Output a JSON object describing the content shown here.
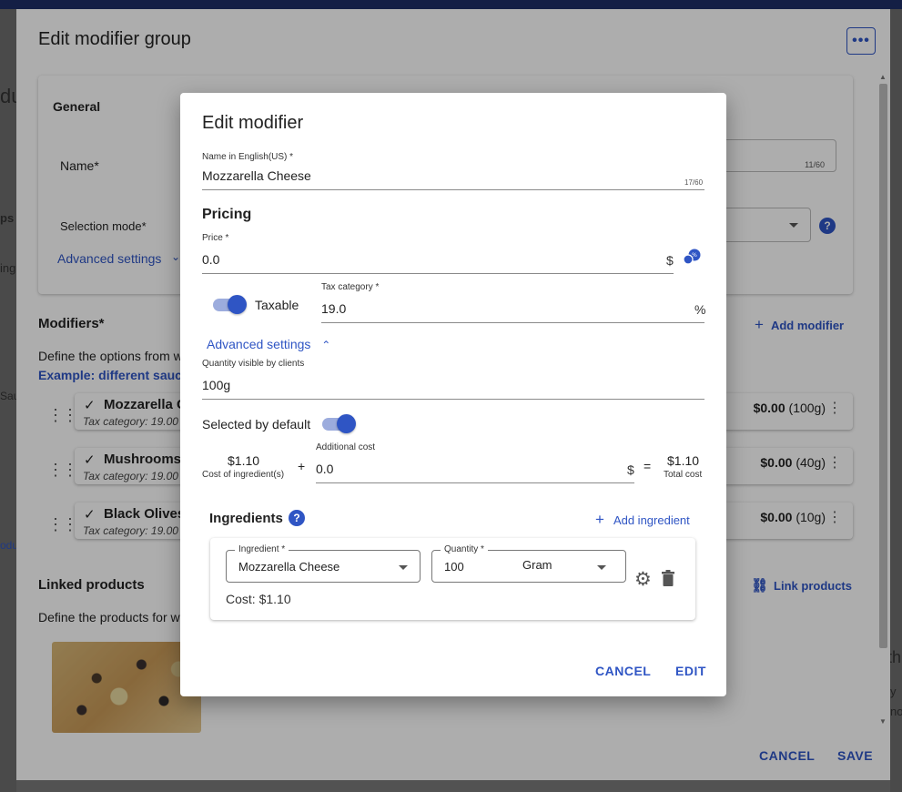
{
  "background": {
    "left_fragments": [
      "du",
      "ps",
      "ing",
      "Sau",
      "odu"
    ],
    "right_fragments": [
      "th",
      "y",
      "no"
    ]
  },
  "outer_dialog": {
    "title": "Edit modifier group",
    "more_icon": "more-horizontal-icon",
    "general": {
      "title": "General",
      "name_label": "Name*",
      "name_counter": "11/60",
      "selection_mode_label": "Selection mode*",
      "advanced_settings": "Advanced settings"
    },
    "modifiers": {
      "title": "Modifiers*",
      "add_modifier": "Add modifier",
      "description": "Define the options from w",
      "example_link": "Example: different sauce",
      "items": [
        {
          "name": "Mozzarella C",
          "tax": "Tax category: 19.00",
          "price": "$0.00",
          "qty": "(100g)"
        },
        {
          "name": "Mushrooms",
          "tax": "Tax category: 19.00",
          "price": "$0.00",
          "qty": "(40g)"
        },
        {
          "name": "Black Olives",
          "tax": "Tax category: 19.00",
          "price": "$0.00",
          "qty": "(10g)"
        }
      ]
    },
    "linked_products": {
      "title": "Linked products",
      "link_products": "Link products",
      "description": "Define the products for w"
    },
    "cancel": "CANCEL",
    "save": "SAVE"
  },
  "dialog": {
    "title": "Edit modifier",
    "name_label": "Name in English(US) *",
    "name_value": "Mozzarella Cheese",
    "name_counter": "17/60",
    "pricing_title": "Pricing",
    "price_label": "Price *",
    "price_value": "0.0",
    "price_suffix": "$",
    "taxable_label": "Taxable",
    "taxable_on": true,
    "tax_label": "Tax category *",
    "tax_value": "19.0",
    "tax_suffix": "%",
    "advanced_settings": "Advanced settings",
    "qty_visible_label": "Quantity visible by clients",
    "qty_visible_value": "100g",
    "selected_default_label": "Selected by default",
    "selected_default_on": true,
    "cost_ingredients_value": "$1.10",
    "cost_ingredients_label": "Cost of ingredient(s)",
    "plus": "+",
    "additional_cost_label": "Additional cost",
    "additional_cost_value": "0.0",
    "additional_cost_suffix": "$",
    "equals": "=",
    "total_cost_value": "$1.10",
    "total_cost_label": "Total cost",
    "ingredients_title": "Ingredients",
    "add_ingredient": "Add ingredient",
    "ingredient": {
      "ingredient_label": "Ingredient *",
      "ingredient_value": "Mozzarella Cheese",
      "quantity_label": "Quantity *",
      "quantity_value": "100",
      "unit_value": "Gram",
      "cost_text": "Cost: $1.10"
    },
    "cancel": "CANCEL",
    "edit": "EDIT"
  },
  "colors": {
    "accent": "#2f55c4",
    "topbar": "#1e2f66"
  }
}
